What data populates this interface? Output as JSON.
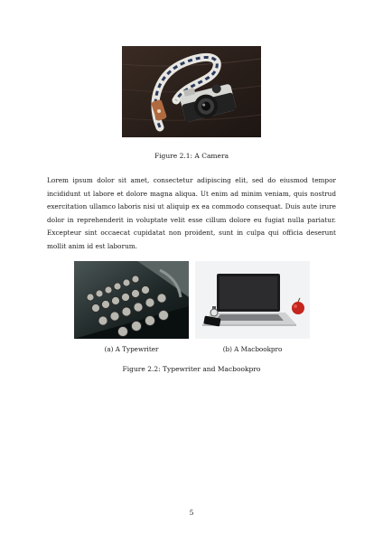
{
  "figure_1": {
    "caption": "Figure 2.1:  A Camera",
    "image": "camera-photo"
  },
  "body_paragraph": "Lorem ipsum dolor sit amet, consectetur adipiscing elit, sed do eiusmod tempor incididunt ut labore et dolore magna aliqua. Ut enim ad minim veniam, quis nostrud exercitation ullamco laboris nisi ut aliquip ex ea commodo consequat. Duis aute irure dolor in reprehenderit in voluptate velit esse cillum dolore eu fugiat nulla pariatur. Excepteur sint occaecat cupidatat non proident, sunt in culpa qui officia deserunt mollit anim id est laborum.",
  "figure_2": {
    "caption": "Figure 2.2: Typewriter and Macbookpro",
    "subfigures": [
      {
        "caption": "(a) A Typewriter",
        "image": "typewriter-photo"
      },
      {
        "caption": "(b) A Macbookpro",
        "image": "macbook-photo"
      }
    ]
  },
  "page_number": "5",
  "colors": {
    "text": "#1a1a1a",
    "page_background": "#ffffff"
  }
}
